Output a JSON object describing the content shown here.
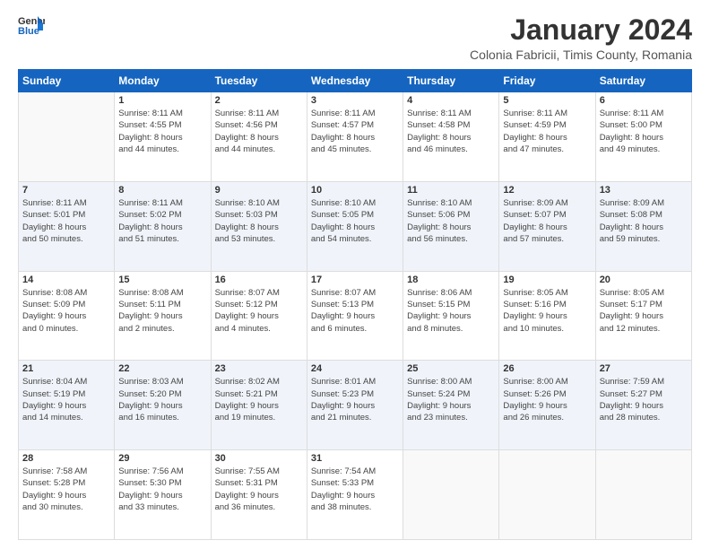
{
  "logo": {
    "text_general": "General",
    "text_blue": "Blue"
  },
  "title": "January 2024",
  "subtitle": "Colonia Fabricii, Timis County, Romania",
  "calendar": {
    "headers": [
      "Sunday",
      "Monday",
      "Tuesday",
      "Wednesday",
      "Thursday",
      "Friday",
      "Saturday"
    ],
    "rows": [
      [
        {
          "day": "",
          "info": ""
        },
        {
          "day": "1",
          "info": "Sunrise: 8:11 AM\nSunset: 4:55 PM\nDaylight: 8 hours\nand 44 minutes."
        },
        {
          "day": "2",
          "info": "Sunrise: 8:11 AM\nSunset: 4:56 PM\nDaylight: 8 hours\nand 44 minutes."
        },
        {
          "day": "3",
          "info": "Sunrise: 8:11 AM\nSunset: 4:57 PM\nDaylight: 8 hours\nand 45 minutes."
        },
        {
          "day": "4",
          "info": "Sunrise: 8:11 AM\nSunset: 4:58 PM\nDaylight: 8 hours\nand 46 minutes."
        },
        {
          "day": "5",
          "info": "Sunrise: 8:11 AM\nSunset: 4:59 PM\nDaylight: 8 hours\nand 47 minutes."
        },
        {
          "day": "6",
          "info": "Sunrise: 8:11 AM\nSunset: 5:00 PM\nDaylight: 8 hours\nand 49 minutes."
        }
      ],
      [
        {
          "day": "7",
          "info": "Sunrise: 8:11 AM\nSunset: 5:01 PM\nDaylight: 8 hours\nand 50 minutes."
        },
        {
          "day": "8",
          "info": "Sunrise: 8:11 AM\nSunset: 5:02 PM\nDaylight: 8 hours\nand 51 minutes."
        },
        {
          "day": "9",
          "info": "Sunrise: 8:10 AM\nSunset: 5:03 PM\nDaylight: 8 hours\nand 53 minutes."
        },
        {
          "day": "10",
          "info": "Sunrise: 8:10 AM\nSunset: 5:05 PM\nDaylight: 8 hours\nand 54 minutes."
        },
        {
          "day": "11",
          "info": "Sunrise: 8:10 AM\nSunset: 5:06 PM\nDaylight: 8 hours\nand 56 minutes."
        },
        {
          "day": "12",
          "info": "Sunrise: 8:09 AM\nSunset: 5:07 PM\nDaylight: 8 hours\nand 57 minutes."
        },
        {
          "day": "13",
          "info": "Sunrise: 8:09 AM\nSunset: 5:08 PM\nDaylight: 8 hours\nand 59 minutes."
        }
      ],
      [
        {
          "day": "14",
          "info": "Sunrise: 8:08 AM\nSunset: 5:09 PM\nDaylight: 9 hours\nand 0 minutes."
        },
        {
          "day": "15",
          "info": "Sunrise: 8:08 AM\nSunset: 5:11 PM\nDaylight: 9 hours\nand 2 minutes."
        },
        {
          "day": "16",
          "info": "Sunrise: 8:07 AM\nSunset: 5:12 PM\nDaylight: 9 hours\nand 4 minutes."
        },
        {
          "day": "17",
          "info": "Sunrise: 8:07 AM\nSunset: 5:13 PM\nDaylight: 9 hours\nand 6 minutes."
        },
        {
          "day": "18",
          "info": "Sunrise: 8:06 AM\nSunset: 5:15 PM\nDaylight: 9 hours\nand 8 minutes."
        },
        {
          "day": "19",
          "info": "Sunrise: 8:05 AM\nSunset: 5:16 PM\nDaylight: 9 hours\nand 10 minutes."
        },
        {
          "day": "20",
          "info": "Sunrise: 8:05 AM\nSunset: 5:17 PM\nDaylight: 9 hours\nand 12 minutes."
        }
      ],
      [
        {
          "day": "21",
          "info": "Sunrise: 8:04 AM\nSunset: 5:19 PM\nDaylight: 9 hours\nand 14 minutes."
        },
        {
          "day": "22",
          "info": "Sunrise: 8:03 AM\nSunset: 5:20 PM\nDaylight: 9 hours\nand 16 minutes."
        },
        {
          "day": "23",
          "info": "Sunrise: 8:02 AM\nSunset: 5:21 PM\nDaylight: 9 hours\nand 19 minutes."
        },
        {
          "day": "24",
          "info": "Sunrise: 8:01 AM\nSunset: 5:23 PM\nDaylight: 9 hours\nand 21 minutes."
        },
        {
          "day": "25",
          "info": "Sunrise: 8:00 AM\nSunset: 5:24 PM\nDaylight: 9 hours\nand 23 minutes."
        },
        {
          "day": "26",
          "info": "Sunrise: 8:00 AM\nSunset: 5:26 PM\nDaylight: 9 hours\nand 26 minutes."
        },
        {
          "day": "27",
          "info": "Sunrise: 7:59 AM\nSunset: 5:27 PM\nDaylight: 9 hours\nand 28 minutes."
        }
      ],
      [
        {
          "day": "28",
          "info": "Sunrise: 7:58 AM\nSunset: 5:28 PM\nDaylight: 9 hours\nand 30 minutes."
        },
        {
          "day": "29",
          "info": "Sunrise: 7:56 AM\nSunset: 5:30 PM\nDaylight: 9 hours\nand 33 minutes."
        },
        {
          "day": "30",
          "info": "Sunrise: 7:55 AM\nSunset: 5:31 PM\nDaylight: 9 hours\nand 36 minutes."
        },
        {
          "day": "31",
          "info": "Sunrise: 7:54 AM\nSunset: 5:33 PM\nDaylight: 9 hours\nand 38 minutes."
        },
        {
          "day": "",
          "info": ""
        },
        {
          "day": "",
          "info": ""
        },
        {
          "day": "",
          "info": ""
        }
      ]
    ]
  }
}
